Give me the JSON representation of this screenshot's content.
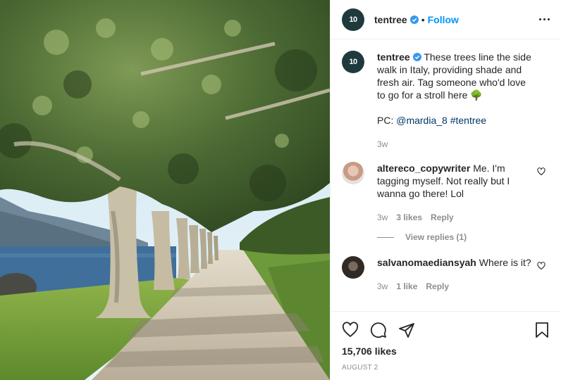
{
  "account": {
    "username": "tentree",
    "avatar_text": "10",
    "follow_label": "Follow",
    "separator": "•"
  },
  "caption": {
    "username": "tentree",
    "text": "These trees line the side walk in Italy, providing shade and fresh air. Tag someone who'd love to go for a stroll here",
    "emoji": "🌳",
    "credit_prefix": "PC:",
    "credit_handle": "@mardia_8",
    "hashtag": "#tentree",
    "age": "3w"
  },
  "comments": [
    {
      "username": "altereco_copywriter",
      "text": "Me. I'm tagging myself. Not really but I wanna go there! Lol",
      "age": "3w",
      "likes": "3 likes",
      "reply_label": "Reply",
      "view_replies": "View replies (1)"
    },
    {
      "username": "salvanomaediansyah",
      "text": "Where is it?",
      "age": "3w",
      "likes": "1 like",
      "reply_label": "Reply"
    }
  ],
  "stats": {
    "likes": "15,706 likes",
    "date": "AUGUST 2"
  },
  "icons": {
    "like": "heart-icon",
    "comment": "comment-icon",
    "share": "share-icon",
    "save": "bookmark-icon",
    "more": "more-options-icon",
    "verified": "verified-badge-icon"
  },
  "colors": {
    "accent": "#0095f6",
    "link": "#00376b",
    "muted": "#8e8e8e",
    "brand_avatar": "#1f3a3d"
  }
}
